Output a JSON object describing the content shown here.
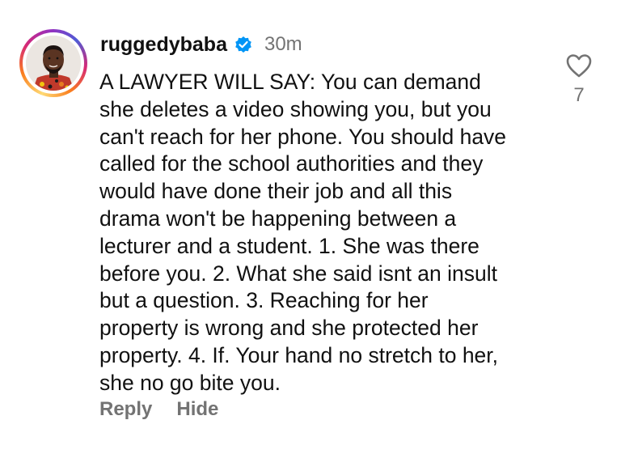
{
  "comment": {
    "username": "ruggedybaba",
    "verified": true,
    "timestamp": "30m",
    "text": "A LAWYER WILL SAY: You can demand\nshe deletes a video showing you, but you\ncan't reach for her phone. You should have\ncalled for the school authorities and they\nwould have done their job and all this\ndrama won't be happening between a\nlecturer and a student. 1. She was there\nbefore you. 2. What she said isnt an insult\nbut a question. 3. Reaching for her\nproperty is wrong and she protected her\nproperty. 4. If. Your hand no stretch to her,\nshe no go bite you.",
    "like_count": "7",
    "actions": {
      "reply_label": "Reply",
      "hide_label": "Hide"
    }
  },
  "icons": {
    "verified": "verified-badge-icon",
    "like": "heart-outline-icon"
  },
  "colors": {
    "verified_blue": "#0095f6",
    "secondary_text": "#737373",
    "primary_text": "#111111"
  }
}
